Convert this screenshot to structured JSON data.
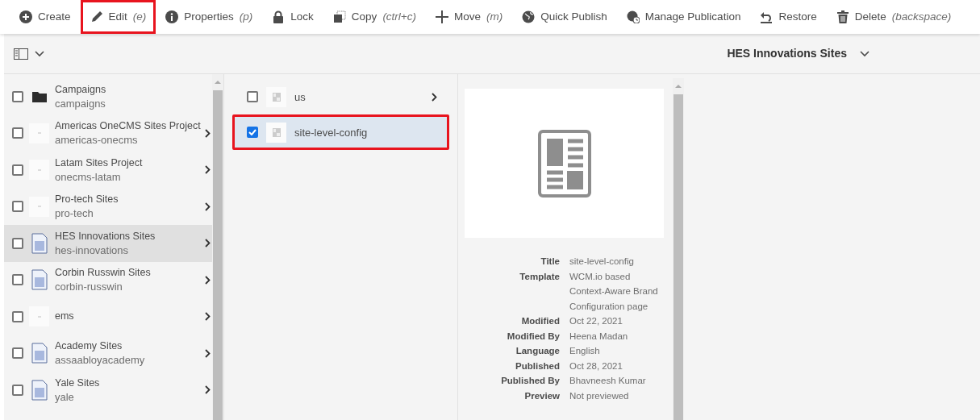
{
  "toolbar": [
    {
      "label": "Create",
      "highlighted": false
    },
    {
      "label": "Edit",
      "shortcut": "(e)",
      "highlighted": true
    },
    {
      "label": "Properties",
      "shortcut": "(p)",
      "highlighted": false
    },
    {
      "label": "Lock",
      "highlighted": false
    },
    {
      "label": "Copy",
      "shortcut": "(ctrl+c)",
      "highlighted": false
    },
    {
      "label": "Move",
      "shortcut": "(m)",
      "highlighted": false
    },
    {
      "label": "Quick Publish",
      "highlighted": false
    },
    {
      "label": "Manage Publication",
      "highlighted": false
    },
    {
      "label": "Restore",
      "highlighted": false
    },
    {
      "label": "Delete",
      "shortcut": "(backspace)",
      "highlighted": false
    }
  ],
  "header": {
    "title": "HES Innovations Sites"
  },
  "columns": [
    {
      "items": [
        {
          "kind": "folder",
          "title": "Campaigns",
          "subtitle": "campaigns",
          "checked": false,
          "selected": false,
          "has_children": false
        },
        {
          "kind": "blank",
          "title": "Americas OneCMS Sites Project",
          "subtitle": "americas-onecms",
          "checked": false,
          "selected": false,
          "has_children": true
        },
        {
          "kind": "blank",
          "title": "Latam Sites Project",
          "subtitle": "onecms-latam",
          "checked": false,
          "selected": false,
          "has_children": true
        },
        {
          "kind": "blank",
          "title": "Pro-tech Sites",
          "subtitle": "pro-tech",
          "checked": false,
          "selected": false,
          "has_children": true
        },
        {
          "kind": "page",
          "title": "HES Innovations Sites",
          "subtitle": "hes-innovations",
          "checked": false,
          "selected": true,
          "has_children": true
        },
        {
          "kind": "page",
          "title": "Corbin Russwin Sites",
          "subtitle": "corbin-russwin",
          "checked": false,
          "selected": false,
          "has_children": true
        },
        {
          "kind": "blank",
          "title": "ems",
          "checked": false,
          "selected": false,
          "has_children": true
        },
        {
          "kind": "page",
          "title": "Academy Sites",
          "subtitle": "assaabloyacademy",
          "checked": false,
          "selected": false,
          "has_children": true
        },
        {
          "kind": "page",
          "title": "Yale Sites",
          "subtitle": "yale",
          "checked": false,
          "selected": false,
          "has_children": true
        }
      ]
    },
    {
      "items": [
        {
          "kind": "template",
          "title": "us",
          "checked": false,
          "selected": false,
          "has_children": true,
          "highlighted": false
        },
        {
          "kind": "template",
          "title": "site-level-config",
          "checked": true,
          "selected": true,
          "has_children": false,
          "highlighted": true
        }
      ]
    }
  ],
  "preview": {
    "meta": [
      {
        "label": "Title",
        "value": "site-level-config"
      },
      {
        "label": "Template",
        "value": "WCM.io based Context-Aware Brand Configuration page"
      },
      {
        "label": "Modified",
        "value": "Oct 22, 2021"
      },
      {
        "label": "Modified By",
        "value": "Heena Madan"
      },
      {
        "label": "Language",
        "value": "English"
      },
      {
        "label": "Published",
        "value": "Oct 28, 2021"
      },
      {
        "label": "Published By",
        "value": "Bhavneesh Kumar"
      },
      {
        "label": "Preview",
        "value": "Not previewed"
      }
    ]
  }
}
